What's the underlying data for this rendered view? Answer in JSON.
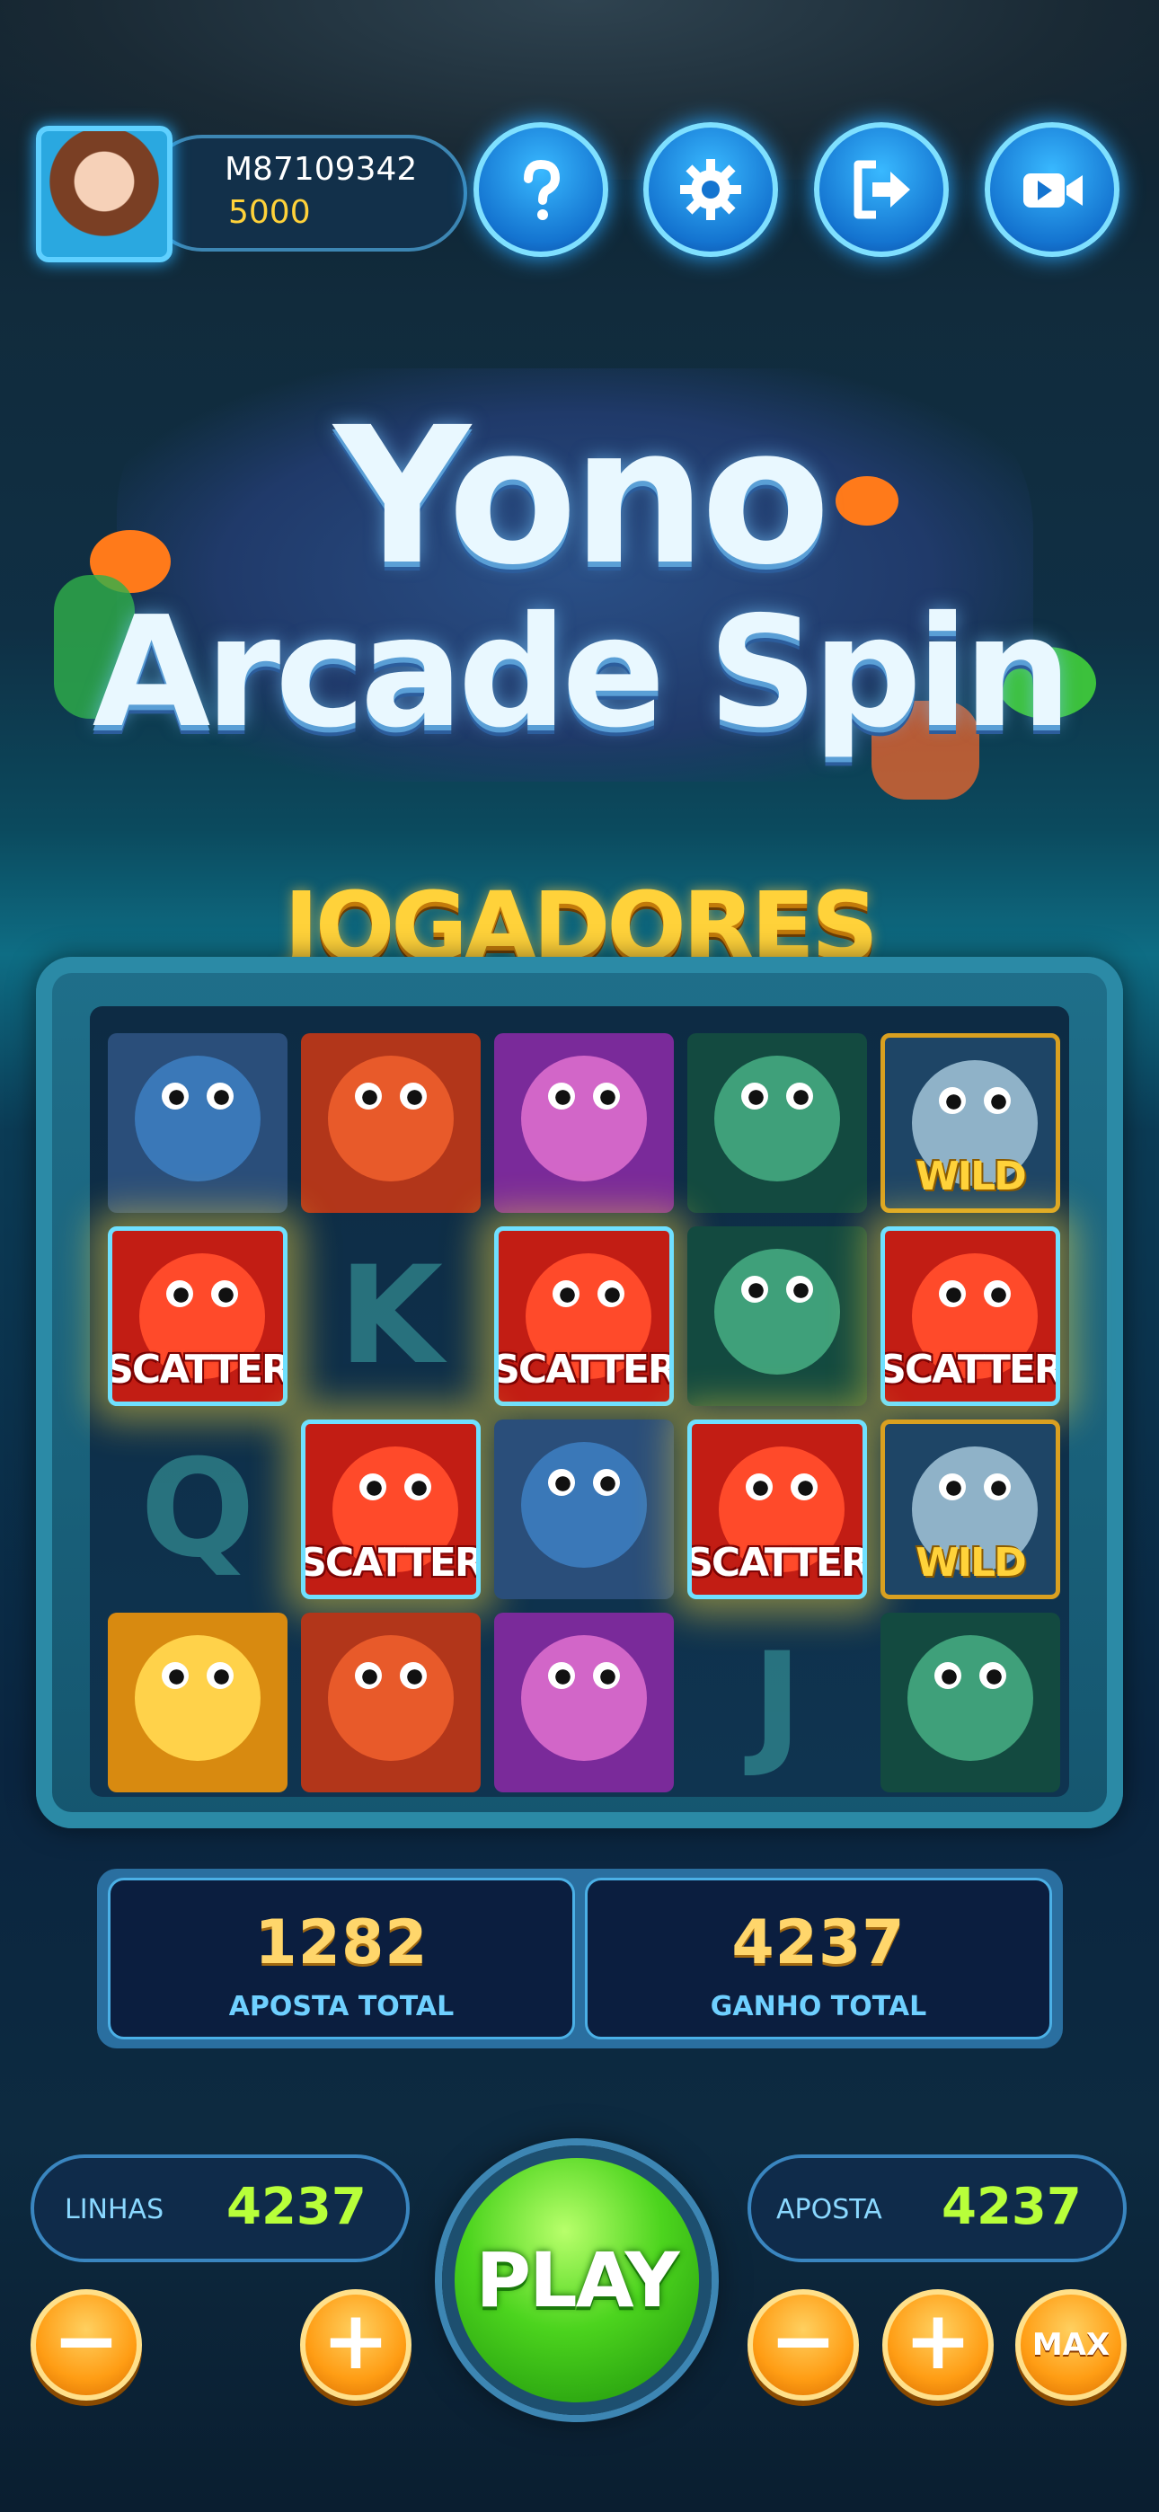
{
  "player": {
    "id": "M87109342",
    "balance": "5000"
  },
  "top_buttons": [
    {
      "name": "help-button",
      "icon": "question-icon"
    },
    {
      "name": "settings-button",
      "icon": "gear-icon"
    },
    {
      "name": "exit-button",
      "icon": "logout-icon"
    },
    {
      "name": "video-button",
      "icon": "video-camera-icon"
    }
  ],
  "logo": {
    "line1": "Yono",
    "line2": "Arcade Spin"
  },
  "heading": "JOGADORES SORTUDOS",
  "reels": {
    "rows": [
      [
        {
          "symbol": "piranha"
        },
        {
          "symbol": "octopus"
        },
        {
          "symbol": "purple-fish"
        },
        {
          "symbol": "turtle"
        },
        {
          "symbol": "shark",
          "label": "WILD"
        }
      ],
      [
        {
          "symbol": "crab",
          "label": "SCATTER"
        },
        {
          "symbol": "letter",
          "text": "K"
        },
        {
          "symbol": "crab",
          "label": "SCATTER"
        },
        {
          "symbol": "turtle"
        },
        {
          "symbol": "crab",
          "label": "SCATTER"
        }
      ],
      [
        {
          "symbol": "letter",
          "text": "Q"
        },
        {
          "symbol": "crab",
          "label": "SCATTER"
        },
        {
          "symbol": "piranha"
        },
        {
          "symbol": "crab",
          "label": "SCATTER"
        },
        {
          "symbol": "shark",
          "label": "WILD"
        }
      ],
      [
        {
          "symbol": "pufferfish"
        },
        {
          "symbol": "octopus"
        },
        {
          "symbol": "purple-fish"
        },
        {
          "symbol": "letter",
          "text": "J"
        },
        {
          "symbol": "turtle"
        }
      ]
    ]
  },
  "stats": {
    "total_bet": {
      "value": "1282",
      "label": "APOSTA TOTAL"
    },
    "total_win": {
      "value": "4237",
      "label": "GANHO TOTAL"
    }
  },
  "controls": {
    "lines": {
      "label": "LINHAS",
      "value": "4237"
    },
    "bet": {
      "label": "APOSTA",
      "value": "4237"
    },
    "play_label": "PLAY",
    "minus": "−",
    "plus": "+",
    "max_label": "MAX"
  },
  "colors": {
    "accent": "#ffd23a",
    "play": "#4cd41e",
    "frame": "#2b8aa6",
    "value_green": "#b8ff3a"
  }
}
